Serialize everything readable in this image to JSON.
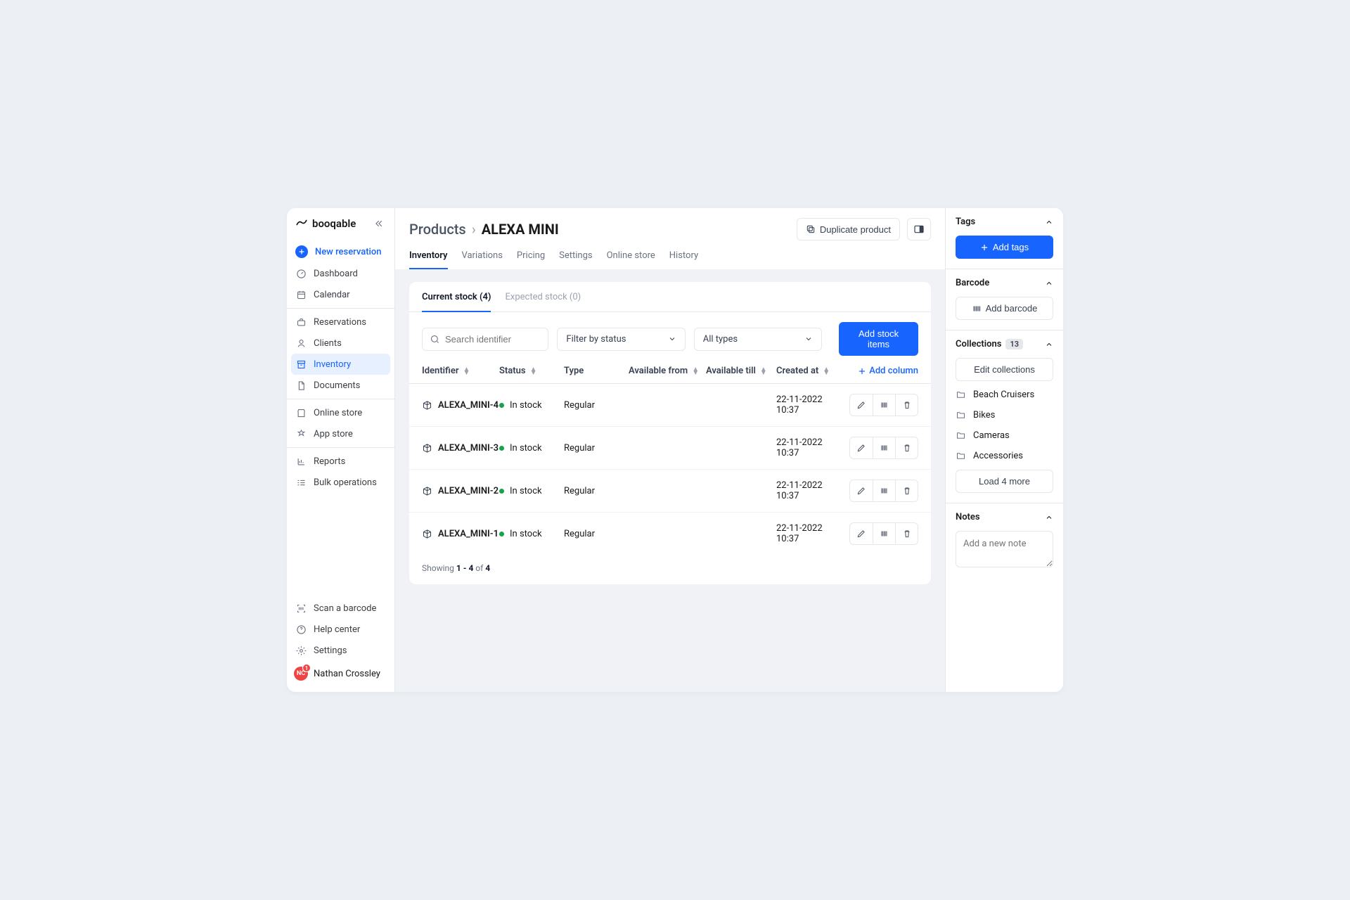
{
  "brand": "booqable",
  "sidebar": {
    "new_reservation": "New reservation",
    "items": [
      {
        "label": "Dashboard"
      },
      {
        "label": "Calendar"
      },
      {
        "label": "Reservations"
      },
      {
        "label": "Clients"
      },
      {
        "label": "Inventory"
      },
      {
        "label": "Documents"
      },
      {
        "label": "Online store"
      },
      {
        "label": "App store"
      },
      {
        "label": "Reports"
      },
      {
        "label": "Bulk operations"
      }
    ],
    "bottom": {
      "scan": "Scan a barcode",
      "help": "Help center",
      "settings": "Settings"
    },
    "user": {
      "name": "Nathan Crossley",
      "initials": "NC",
      "badge": "1"
    }
  },
  "header": {
    "breadcrumb_parent": "Products",
    "title": "ALEXA MINI",
    "duplicate": "Duplicate product"
  },
  "tabs": [
    "Inventory",
    "Variations",
    "Pricing",
    "Settings",
    "Online store",
    "History"
  ],
  "subtabs": {
    "current": "Current stock (4)",
    "expected": "Expected stock (0)"
  },
  "filters": {
    "search_placeholder": "Search identifier",
    "status": "Filter by status",
    "type": "All types",
    "add_stock": "Add stock items"
  },
  "columns": {
    "identifier": "Identifier",
    "status": "Status",
    "type": "Type",
    "from": "Available from",
    "till": "Available till",
    "created": "Created at",
    "add": "Add column"
  },
  "rows": [
    {
      "id": "ALEXA_MINI-4",
      "status": "In stock",
      "type": "Regular",
      "from": "",
      "till": "",
      "created": "22-11-2022 10:37"
    },
    {
      "id": "ALEXA_MINI-3",
      "status": "In stock",
      "type": "Regular",
      "from": "",
      "till": "",
      "created": "22-11-2022 10:37"
    },
    {
      "id": "ALEXA_MINI-2",
      "status": "In stock",
      "type": "Regular",
      "from": "",
      "till": "",
      "created": "22-11-2022 10:37"
    },
    {
      "id": "ALEXA_MINI-1",
      "status": "In stock",
      "type": "Regular",
      "from": "",
      "till": "",
      "created": "22-11-2022 10:37"
    }
  ],
  "footer": {
    "prefix": "Showing ",
    "range": "1 - 4",
    "of": " of ",
    "total": "4"
  },
  "rpanel": {
    "tags": {
      "title": "Tags",
      "add": "Add tags"
    },
    "barcode": {
      "title": "Barcode",
      "add": "Add barcode"
    },
    "collections": {
      "title": "Collections",
      "count": "13",
      "edit": "Edit collections",
      "items": [
        "Beach Cruisers",
        "Bikes",
        "Cameras",
        "Accessories"
      ],
      "load_more": "Load 4 more"
    },
    "notes": {
      "title": "Notes",
      "placeholder": "Add a new note"
    }
  }
}
